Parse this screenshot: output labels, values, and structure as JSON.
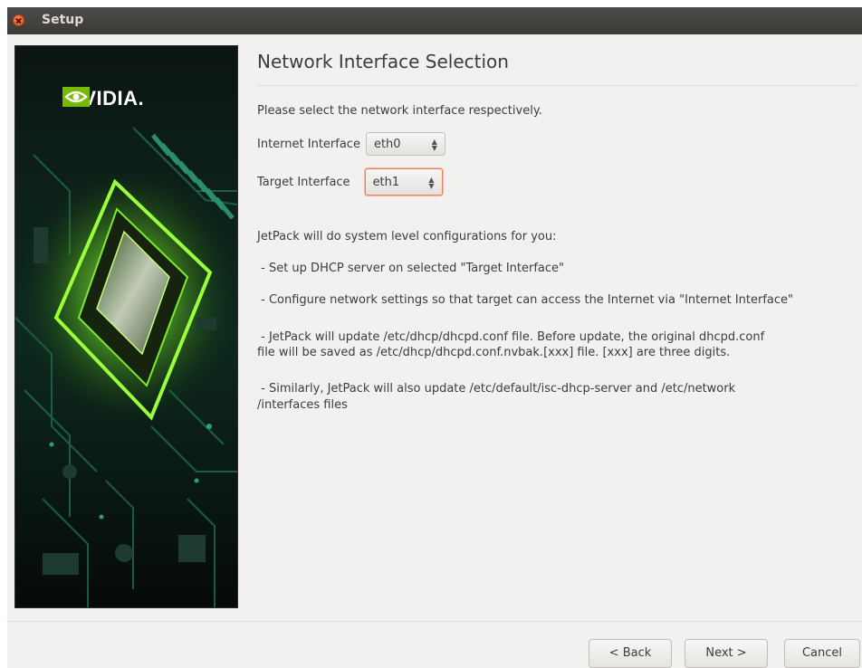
{
  "window": {
    "title": "Setup"
  },
  "banner": {
    "logo_text": "NVIDIA."
  },
  "page": {
    "title": "Network Interface Selection",
    "instruction": "Please select the network interface respectively."
  },
  "interfaces": {
    "internet_label": "Internet Interface",
    "internet_value": "eth0",
    "target_label": "Target Interface",
    "target_value": "eth1"
  },
  "info": {
    "heading": "JetPack will do system level configurations for you:",
    "item1": " - Set up DHCP server on selected \"Target Interface\"",
    "item2": " - Configure network settings so that target can access the Internet via \"Internet Interface\"",
    "item3_line1": " - JetPack will update /etc/dhcp/dhcpd.conf file. Before update, the original dhcpd.conf",
    "item3_line2": "file will be saved as /etc/dhcp/dhcpd.conf.nvbak.[xxx] file. [xxx] are three digits.",
    "item4_line1": " - Similarly, JetPack will also update /etc/default/isc-dhcp-server and /etc/network",
    "item4_line2": "/interfaces files"
  },
  "buttons": {
    "back": "< Back",
    "next": "Next >",
    "cancel": "Cancel"
  },
  "colors": {
    "accent_focus": "#e9825f",
    "nvidia_green": "#76b900"
  }
}
